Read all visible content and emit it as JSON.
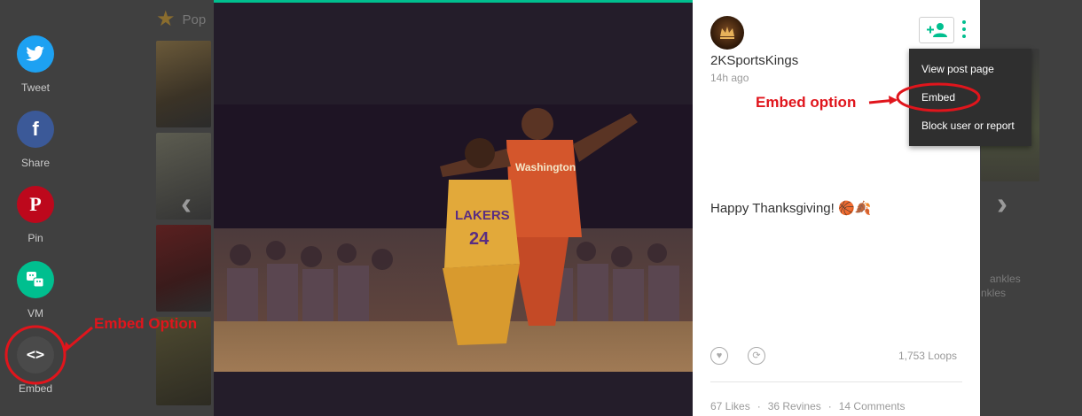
{
  "background": {
    "section_title": "Pop",
    "right_text_lines": [
      "ankles",
      "nkles"
    ]
  },
  "share": [
    {
      "label": "Tweet",
      "icon": "twitter-bird-icon",
      "color": "#1da1f2"
    },
    {
      "label": "Share",
      "icon": "facebook-f-icon",
      "color": "#3b5998"
    },
    {
      "label": "Pin",
      "icon": "pinterest-p-icon",
      "color": "#bd081c"
    },
    {
      "label": "VM",
      "icon": "vine-messages-icon",
      "color": "#00bf8f"
    },
    {
      "label": "Embed",
      "icon": "code-brackets-icon",
      "color": "#4a4a4a"
    }
  ],
  "video": {
    "jersey_home": "LAKERS",
    "jersey_home_number": "24",
    "jersey_away": "Washington"
  },
  "post": {
    "username": "2KSportsKings",
    "time": "14h ago",
    "caption": "Happy Thanksgiving! 🏀🍂",
    "loops": "1,753 Loops",
    "likes": "67 Likes",
    "revines": "36 Revines",
    "comments": "14 Comments",
    "separator": "·"
  },
  "menu": {
    "items": [
      "View post page",
      "Embed",
      "Block user or report"
    ]
  },
  "annotations": {
    "embed_option_sidebar": "Embed Option",
    "embed_option_menu": "Embed option",
    "color": "#e0151c"
  },
  "colors": {
    "accent": "#00bf8f",
    "overlay": "#404040"
  }
}
